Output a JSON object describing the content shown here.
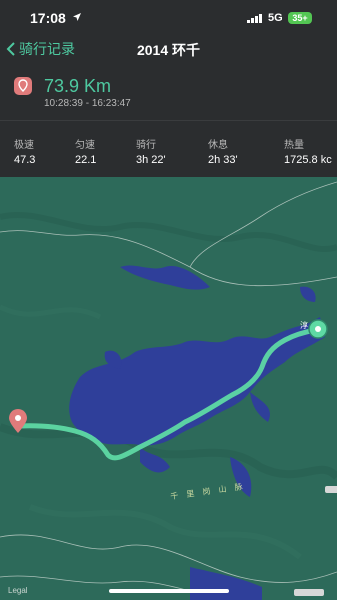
{
  "status_bar": {
    "time": "17:08",
    "network": "5G",
    "battery": "35+"
  },
  "nav": {
    "back_label": "骑行记录",
    "title": "2014 环千"
  },
  "summary": {
    "distance": "73.9 Km",
    "time_range": "10:28:39 - 16:23:47"
  },
  "stats": [
    {
      "label": "极速",
      "value": "47.3"
    },
    {
      "label": "匀速",
      "value": "22.1"
    },
    {
      "label": "骑行",
      "value": "3h 22'"
    },
    {
      "label": "休息",
      "value": "2h 33'"
    },
    {
      "label": "热量",
      "value": "1725.8 kc"
    }
  ],
  "map": {
    "city_label": "淳",
    "road_label": "千 里 岗 山 脉",
    "legal": "Legal"
  },
  "colors": {
    "accent": "#4ec9a0",
    "route": "#5ed9a4",
    "water": "#2f3f9a",
    "land": "#2d6a5a",
    "pin": "#e07b7b"
  }
}
